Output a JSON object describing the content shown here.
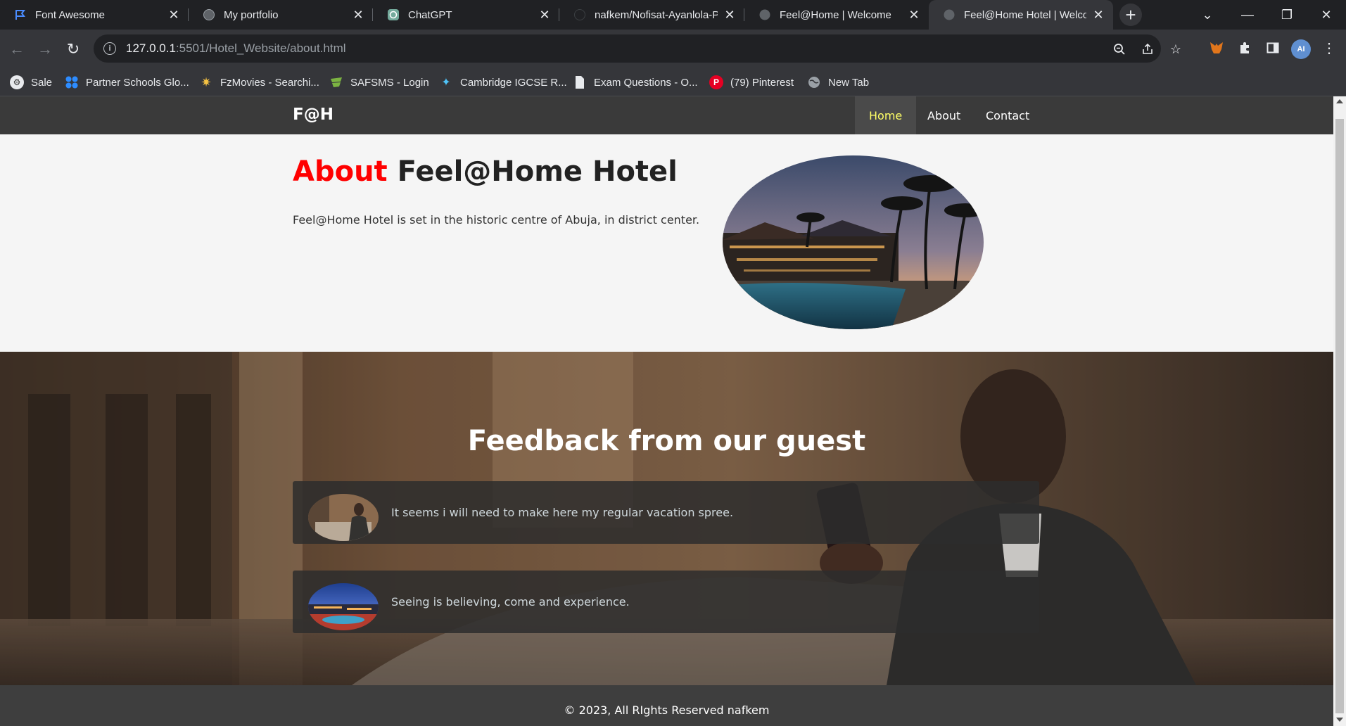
{
  "browser": {
    "tabs": [
      {
        "title": "Font Awesome",
        "icon": "flag-icon"
      },
      {
        "title": "My portfolio",
        "icon": "globe-icon"
      },
      {
        "title": "ChatGPT",
        "icon": "chatgpt-icon"
      },
      {
        "title": "nafkem/Nofisat-Ayanlola-P",
        "icon": "github-icon"
      },
      {
        "title": "Feel@Home | Welcome",
        "icon": "globe-icon"
      },
      {
        "title": "Feel@Home Hotel | Welcom",
        "icon": "globe-icon",
        "active": true
      }
    ],
    "url_host": "127.0.0.1",
    "url_rest": ":5501/Hotel_Website/about.html",
    "bookmarks": [
      {
        "label": "Sale",
        "icon": "sale-icon"
      },
      {
        "label": "Partner Schools Glo...",
        "icon": "partner-icon"
      },
      {
        "label": "FzMovies - Searchi...",
        "icon": "fzmovies-icon"
      },
      {
        "label": "SAFSMS - Login",
        "icon": "safsms-icon"
      },
      {
        "label": "Cambridge IGCSE R...",
        "icon": "cambridge-icon"
      },
      {
        "label": "Exam Questions - O...",
        "icon": "document-icon"
      },
      {
        "label": "(79) Pinterest",
        "icon": "pinterest-icon"
      },
      {
        "label": "New Tab",
        "icon": "globe-icon"
      }
    ],
    "avatar_initials": "AI"
  },
  "site": {
    "logo": "F@H",
    "nav": [
      {
        "label": "Home",
        "active": true
      },
      {
        "label": "About"
      },
      {
        "label": "Contact"
      }
    ],
    "about": {
      "title_highlight": "About",
      "title_rest": "Feel@Home Hotel",
      "text": "Feel@Home Hotel is set in the historic centre of Abuja, in district center."
    },
    "feedback": {
      "title": "Feedback from our guest",
      "items": [
        {
          "text": "It seems i will need to make here my regular vacation spree."
        },
        {
          "text": "Seeing is believing, come and experience."
        }
      ]
    },
    "footer": "© 2023, All RIghts Reserved nafkem"
  },
  "colors": {
    "accent_red": "#ff0000",
    "nav_active": "#ffff66",
    "nav_bg": "#3a3a3a"
  }
}
